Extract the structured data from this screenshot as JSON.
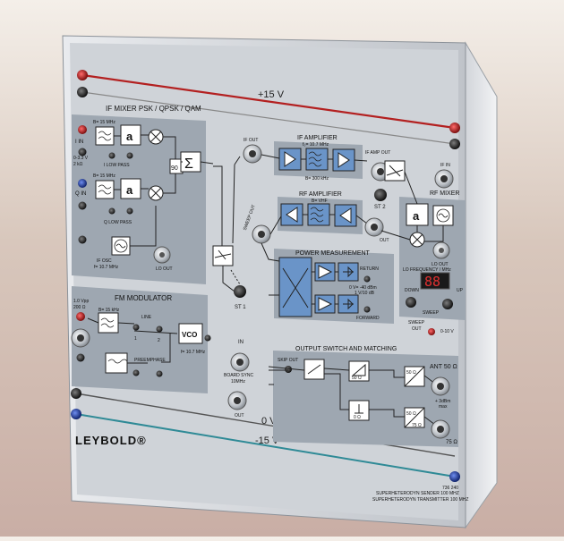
{
  "rails": {
    "plus15": "+15 V",
    "zero": "0 V",
    "minus15": "-15 V"
  },
  "if_mixer": {
    "title": "IF MIXER PSK / QPSK / QAM",
    "i_in": "I IN",
    "q_in": "Q IN",
    "b_top": "B= 15 MHz",
    "b_bottom": "B= 15 MHz",
    "range": "0-3.3 V",
    "imp": "2 kΩ",
    "i_low_pass": "I LOW PASS",
    "q_low_pass": "Q LOW PASS",
    "a_label": "a",
    "ninety": "90",
    "sigma": "Σ",
    "if_osc": "IF OSC",
    "if_osc_f": "f= 10.7 MHz",
    "lo_out": "LO OUT",
    "n1": "1",
    "n2": "2"
  },
  "fm_modulator": {
    "title": "FM MODULATOR",
    "vpp": "1.0 Vpp",
    "ohm": "200 Ω",
    "b": "B= 15 kHz",
    "line": "LINE",
    "preemphase": "PREEMPHASE",
    "vco": "VCO",
    "f": "f= 10.7 MHz",
    "n1": "1",
    "n2": "2"
  },
  "if_amplifier": {
    "title": "IF AMPLIFIER",
    "f": "f₀= 10.7 MHz",
    "b": "B= 300 kHz",
    "if_out": "IF OUT",
    "if_amp_out": "IF AMP OUT",
    "st2": "ST 2"
  },
  "rf_amplifier": {
    "title": "RF AMPLIFIER",
    "b": "B= VHF",
    "out": "OUT",
    "sweep_out": "SWEEP OUT"
  },
  "power_measurement": {
    "title": "POWER MEASUREMENT",
    "return": "RETURN",
    "forward": "FORWARD",
    "dbm": "0 V= -40 dBm",
    "v10": "1 V/10 dB"
  },
  "rf_mixer": {
    "title": "RF MIXER",
    "if_in": "IF IN",
    "a_label": "a",
    "lo_out": "LO OUT",
    "lo_freq": "LO FREQUENCY / MHz",
    "display": "88",
    "down": "DOWN",
    "up": "UP",
    "sweep": "SWEEP",
    "sweep_out": "SWEEP",
    "out": "OUT",
    "v": "0-10 V"
  },
  "center": {
    "st1": "ST 1",
    "in": "IN",
    "board_sync": "BOARD SYNC",
    "board_sync_f": "10MHz",
    "out": "OUT"
  },
  "output_switch": {
    "title": "OUTPUT SWITCH AND MATCHING",
    "skip_out": "SKIP OUT",
    "r50a": "50 Ω",
    "r50b": "50 Ω",
    "r50c": "50 Ω",
    "r0": "0 Ω",
    "r75": "75 Ω",
    "ant": "ANT 50 Ω",
    "dbm": "+ 3dBm",
    "max": "max",
    "out75": "75 Ω"
  },
  "branding": {
    "logo": "LEYBOLD®",
    "catalog": "736 240",
    "line1": "SUPERHETERODYN SENDER 100 MHZ",
    "line2": "SUPERHETERODYN TRANSMITTER 100 MHZ"
  },
  "colors": {
    "panel": "#cfd3d8",
    "block": "#9ea7b1",
    "red": "#b32020",
    "blue": "#1d3fa8",
    "teal": "#2f8a96",
    "accent_fill": "#6a94c8"
  }
}
